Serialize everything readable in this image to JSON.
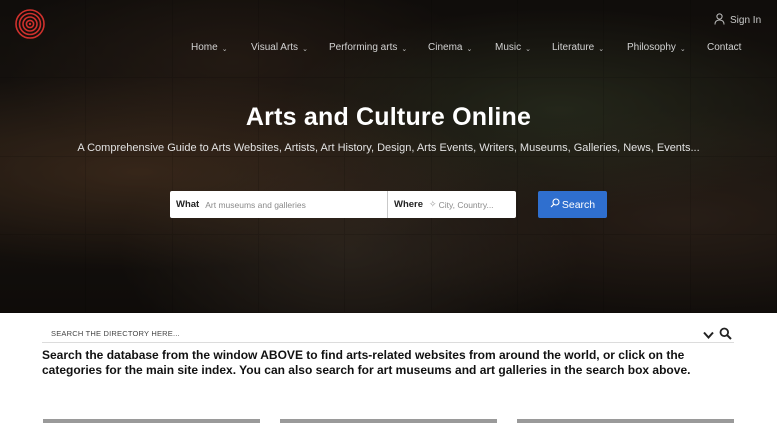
{
  "header": {
    "signin_label": "Sign In",
    "nav": [
      {
        "label": "Home",
        "has_dropdown": true
      },
      {
        "label": "Visual Arts",
        "has_dropdown": true
      },
      {
        "label": "Performing arts",
        "has_dropdown": true
      },
      {
        "label": "Cinema",
        "has_dropdown": true
      },
      {
        "label": "Music",
        "has_dropdown": true
      },
      {
        "label": "Literature",
        "has_dropdown": true
      },
      {
        "label": "Philosophy",
        "has_dropdown": true
      },
      {
        "label": "Contact",
        "has_dropdown": false
      }
    ]
  },
  "hero": {
    "title": "Arts and Culture Online",
    "subtitle": "A Comprehensive Guide to Arts Websites, Artists, Art History, Design, Arts Events, Writers, Museums, Galleries, News, Events..."
  },
  "search": {
    "what_label": "What",
    "what_placeholder": "Art museums and galleries",
    "where_label": "Where",
    "where_placeholder": "City, Country...",
    "button_label": "Search"
  },
  "directory": {
    "placeholder": "SEARCH THE DIRECTORY HERE..."
  },
  "intro_text": "Search the database from the window ABOVE to find arts-related websites from around the world, or click on the categories for the main site index. You can also search for art museums and art galleries in the search box above.",
  "colors": {
    "accent": "#2f6fcf",
    "logo": "#d0312d"
  },
  "icons": {
    "logo": "spiral-logo-icon",
    "user": "user-icon",
    "search": "search-icon",
    "location": "location-icon",
    "chevron": "chevron-down-icon"
  }
}
